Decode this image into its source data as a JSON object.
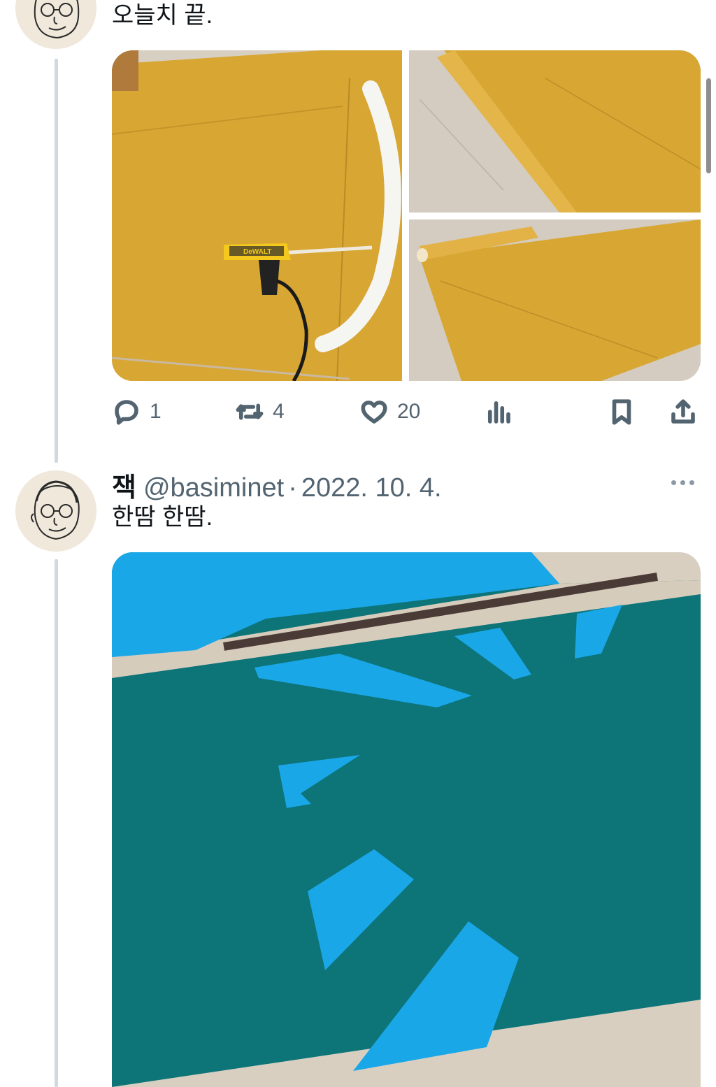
{
  "tweet1": {
    "text": "오늘치 끝.",
    "stats": {
      "replies": "1",
      "retweets": "4",
      "likes": "20"
    },
    "photo_labels": {
      "glue_gun_brand": "DeWALT"
    }
  },
  "tweet2": {
    "name": "잭",
    "handle": "@basiminet",
    "separator": "·",
    "date": "2022. 10. 4.",
    "text": "한땀 한땀."
  },
  "colors": {
    "felt_mustard": "#d8a632",
    "felt_teal": "#0d7478",
    "felt_blue": "#1aa7e8",
    "floor": "#d6cdbf",
    "icon_gray": "#536471",
    "thread_line": "#cfd9de"
  },
  "icons": [
    "reply-icon",
    "retweet-icon",
    "like-icon",
    "views-icon",
    "bookmark-icon",
    "share-icon",
    "more-icon"
  ]
}
